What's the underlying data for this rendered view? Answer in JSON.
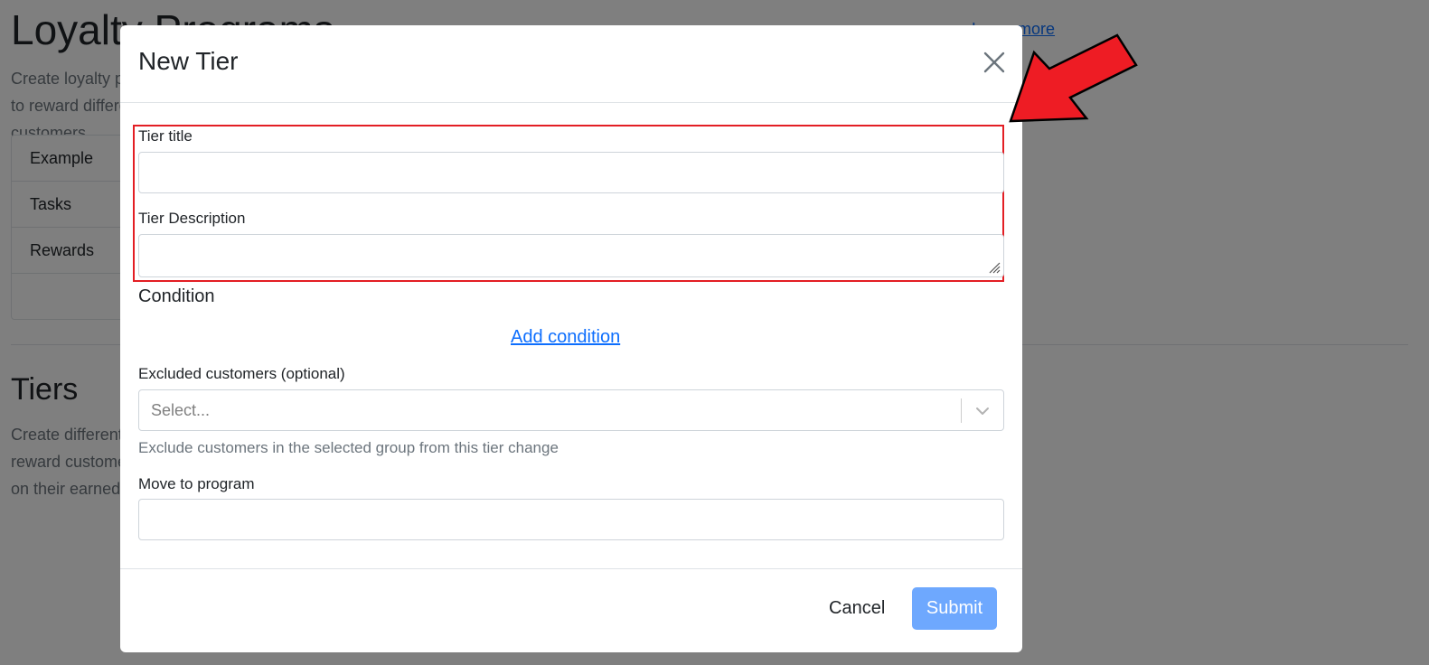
{
  "background": {
    "title": "Loyalty Programs",
    "description": "Create loyalty programs to reward different customers",
    "top_link": "Learn more",
    "list_items": [
      "Example",
      "Tasks",
      "Rewards"
    ],
    "tiers_heading": "Tiers",
    "tiers_description": "Create different tiers to reward customers based on their earned points"
  },
  "modal": {
    "title": "New Tier",
    "close_icon": "close-icon",
    "fields": {
      "tier_title_label": "Tier title",
      "tier_title_value": "",
      "tier_description_label": "Tier Description",
      "tier_description_value": "",
      "condition_heading": "Condition",
      "add_condition_link": "Add condition",
      "excluded_label": "Excluded customers (optional)",
      "excluded_placeholder": "Select...",
      "excluded_help": "Exclude customers in the selected group from this tier change",
      "move_label": "Move to program",
      "move_value": ""
    },
    "footer": {
      "cancel_label": "Cancel",
      "submit_label": "Submit"
    }
  },
  "colors": {
    "highlight": "#e31e24",
    "arrow": "#ee1c24",
    "primary_disabled": "#6ea8fe",
    "link": "#0d6efd"
  }
}
